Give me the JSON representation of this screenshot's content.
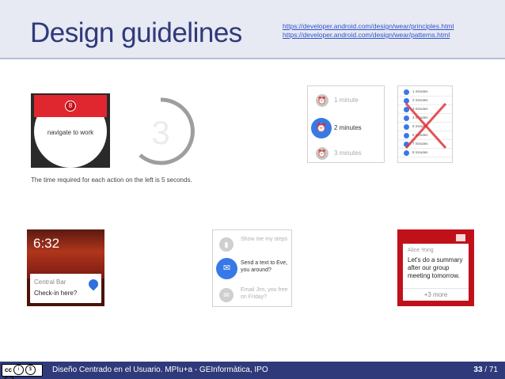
{
  "header": {
    "title": "Design guidelines",
    "links": [
      "https://developer.android.com/design/wear/principles.html",
      "https://developer.android.com/design/wear/patterns.html"
    ]
  },
  "watch_notification": {
    "badge": "8",
    "text": "navigate to work"
  },
  "countdown": {
    "digit": "3"
  },
  "caption": "The time required for each action on the left is 5 seconds.",
  "minutes_picker": {
    "items": [
      {
        "label": "1 minute"
      },
      {
        "label": "2 minutes"
      },
      {
        "label": "3 minutes"
      }
    ]
  },
  "minutes_list": {
    "items": [
      "1 minutes",
      "2 minutes",
      "3 minutes",
      "4 minutes",
      "5 minutes",
      "6 minutes",
      "7 minutes",
      "8 minutes"
    ]
  },
  "location_card": {
    "time": "6:32",
    "place": "Central Bar",
    "prompt": "Check-in here?"
  },
  "actions_card": {
    "items": [
      {
        "label": "Show me my steps"
      },
      {
        "label": "Send a text to Eve, you around?"
      },
      {
        "label": "Email Jim, you free on Friday?"
      }
    ]
  },
  "message_card": {
    "sender": "Alice Yong",
    "body": "Let's do a summary after our group meeting tomorrow.",
    "more": "+3 more"
  },
  "footer": {
    "license": "cc",
    "text": "Diseño Centrado en el Usuario. MPIu+a - GEInformàtica, IPO",
    "page_current": "33",
    "page_total": "/ 71"
  },
  "colors": {
    "title": "#2f3a7a",
    "footer_bg": "#2f3a7a",
    "accent_blue": "#3779e6",
    "accent_red": "#c0111b"
  }
}
